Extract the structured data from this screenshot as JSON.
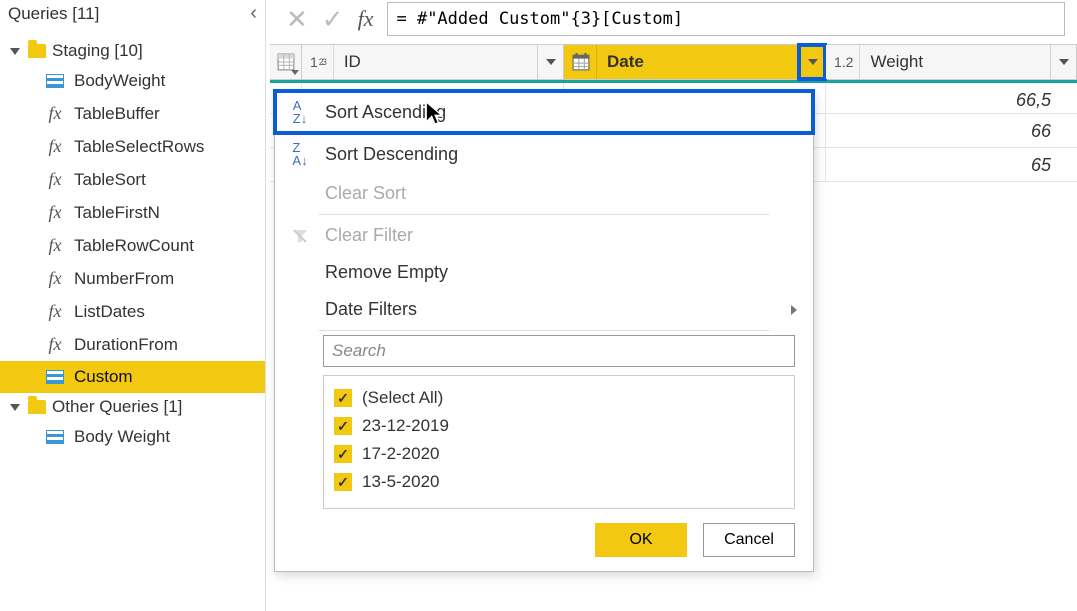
{
  "sidebar": {
    "title": "Queries [11]",
    "folders": [
      {
        "label": "Staging [10]",
        "items": [
          {
            "icon": "table",
            "label": "BodyWeight"
          },
          {
            "icon": "fx",
            "label": "TableBuffer"
          },
          {
            "icon": "fx",
            "label": "TableSelectRows"
          },
          {
            "icon": "fx",
            "label": "TableSort"
          },
          {
            "icon": "fx",
            "label": "TableFirstN"
          },
          {
            "icon": "fx",
            "label": "TableRowCount"
          },
          {
            "icon": "fx",
            "label": "NumberFrom"
          },
          {
            "icon": "fx",
            "label": "ListDates"
          },
          {
            "icon": "fx",
            "label": "DurationFrom"
          },
          {
            "icon": "table",
            "label": "Custom",
            "selected": true
          }
        ]
      },
      {
        "label": "Other Queries [1]",
        "items": [
          {
            "icon": "table",
            "label": "Body Weight"
          }
        ]
      }
    ]
  },
  "formula_bar": {
    "value": "= #\"Added Custom\"{3}[Custom]"
  },
  "columns": {
    "id": {
      "type": "1²3",
      "label": "ID"
    },
    "date": {
      "label": "Date"
    },
    "weight": {
      "type": "1.2",
      "label": "Weight"
    }
  },
  "rows": [
    {
      "weight": "66,5"
    },
    {
      "weight": "66"
    },
    {
      "weight": "65"
    }
  ],
  "menu": {
    "sort_asc": "Sort Ascending",
    "sort_desc": "Sort Descending",
    "clear_sort": "Clear Sort",
    "clear_filter": "Clear Filter",
    "remove_empty": "Remove Empty",
    "date_filters": "Date Filters",
    "search_placeholder": "Search",
    "options": [
      "(Select All)",
      "23-12-2019",
      "17-2-2020",
      "13-5-2020"
    ],
    "ok": "OK",
    "cancel": "Cancel"
  }
}
